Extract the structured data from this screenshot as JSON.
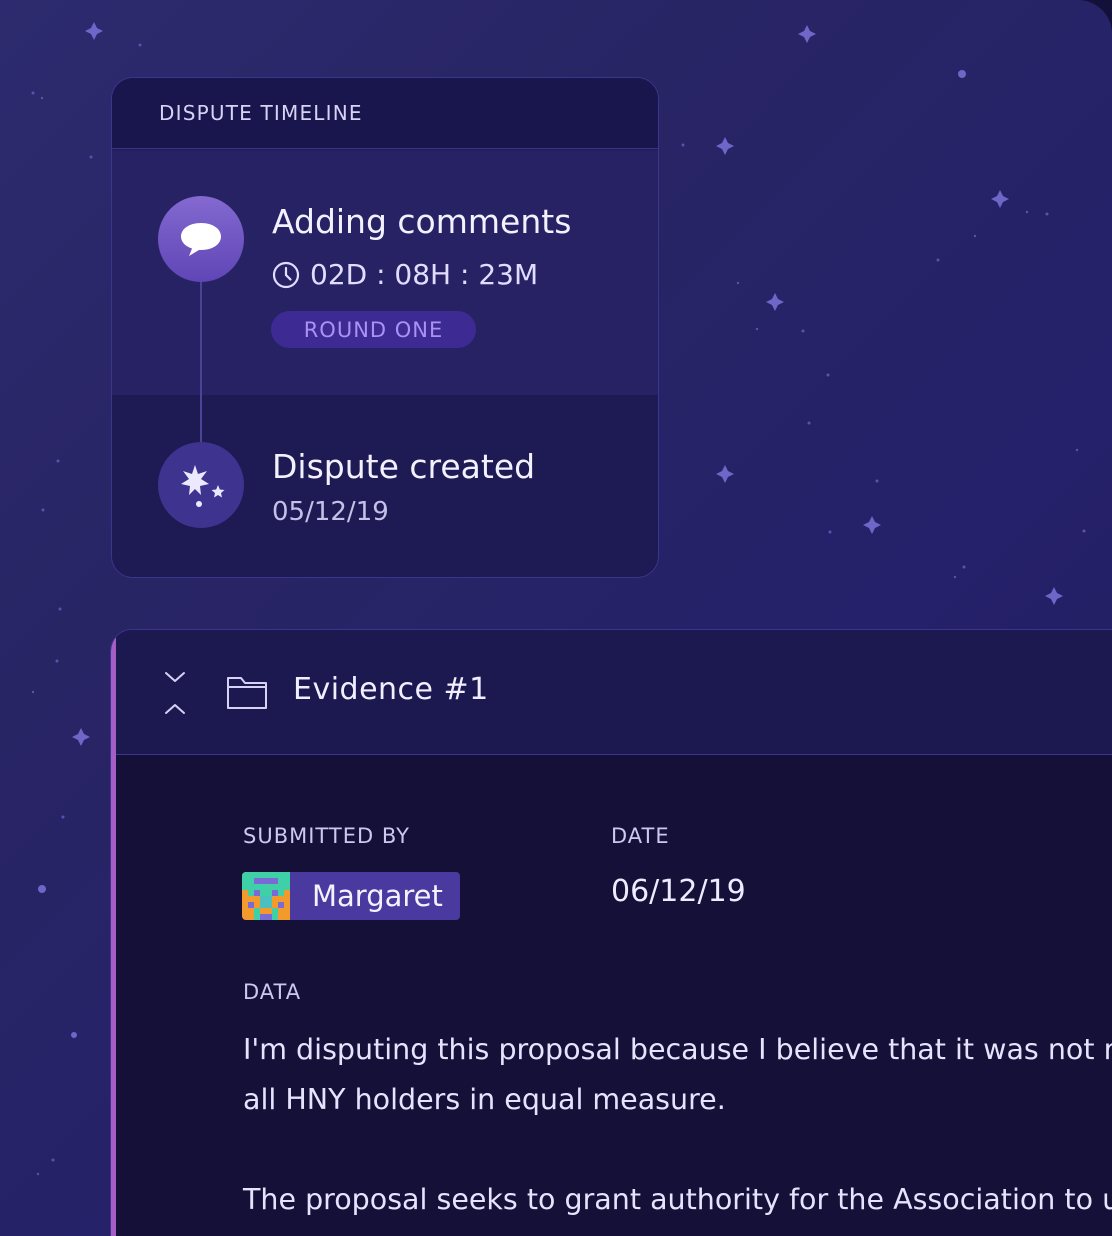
{
  "timeline": {
    "header": "DISPUTE TIMELINE",
    "steps": [
      {
        "title": "Adding comments",
        "countdown": "02D : 08H : 23M",
        "badge": "ROUND ONE",
        "icon": "speech-bubble-icon"
      },
      {
        "title": "Dispute created",
        "date": "05/12/19",
        "icon": "sparkles-icon"
      }
    ]
  },
  "evidence": {
    "title": "Evidence #1",
    "submitted_by_label": "SUBMITTED BY",
    "submitter": "Margaret",
    "date_label": "DATE",
    "date": "06/12/19",
    "data_label": "DATA",
    "paragraphs": [
      "I'm disputing this proposal because I believe that it was not made for",
      "all HNY holders in equal measure.",
      "The proposal seeks to grant authority for the Association to use"
    ]
  },
  "colors": {
    "background": "#282565",
    "card": "#1e1a54",
    "accent": "#a55ec5",
    "badge_bg": "#3d2b93",
    "badge_text": "#a991f6"
  }
}
